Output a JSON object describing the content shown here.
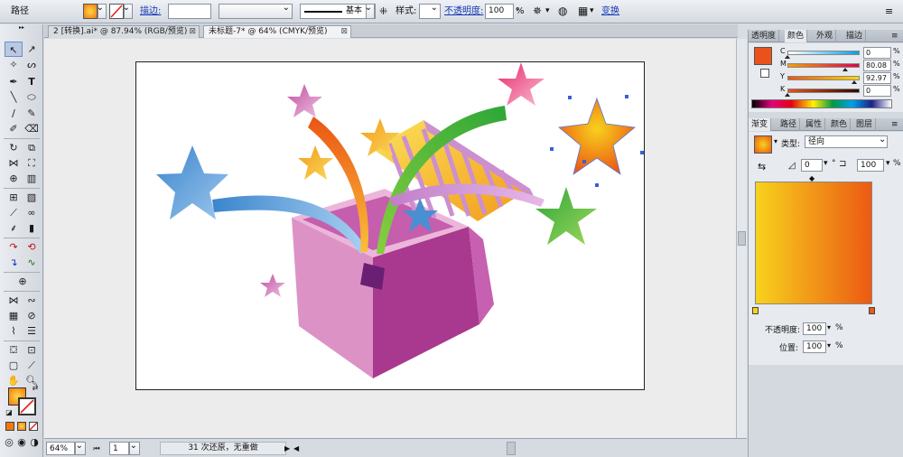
{
  "control_bar": {
    "path_label": "路径",
    "fill_color": "#f07a10",
    "stroke_label": "描边:",
    "stroke_weight": "",
    "brush_label": "基本",
    "style_label": "样式:",
    "opacity_label": "不透明度:",
    "opacity_value": "100",
    "opacity_unit": "%",
    "transform_label": "变换"
  },
  "tabs": [
    {
      "label": "2 [转换].ai* @ 87.94% (RGB/预览)",
      "close": "⊠"
    },
    {
      "label": "未标题-7* @ 64% (CMYK/预览)",
      "close": "⊠"
    }
  ],
  "status": {
    "zoom": "64%",
    "page": "1",
    "message": "31 次还原，无重做",
    "play_icon": "▶",
    "prev_icon": "◀"
  },
  "color_panel": {
    "tabs": [
      "透明度",
      "颜色",
      "外观",
      "描边"
    ],
    "active_tab": "颜色",
    "fill_color": "#e9521a",
    "channels": [
      {
        "name": "C",
        "value": "0",
        "unit": "%",
        "gradient": [
          "#ffffff",
          "#00a0e9"
        ]
      },
      {
        "name": "M",
        "value": "80.08",
        "unit": "%",
        "gradient": [
          "#f5a000",
          "#e2004d"
        ]
      },
      {
        "name": "Y",
        "value": "92.97",
        "unit": "%",
        "gradient": [
          "#ea5514",
          "#ffd800"
        ]
      },
      {
        "name": "K",
        "value": "0",
        "unit": "%",
        "gradient": [
          "#e9521a",
          "#2a0a00"
        ]
      }
    ]
  },
  "gradient_panel": {
    "tabs": [
      "渐变",
      "路径",
      "属性",
      "颜色",
      "图层"
    ],
    "active_tab": "渐变",
    "type_label": "类型:",
    "type_value": "径向",
    "angle_value": "0",
    "angle_unit": "°",
    "ratio_value": "100",
    "ratio_unit": "%",
    "start_color": "#f7d21c",
    "end_color": "#ec5a14",
    "opacity_label": "不透明度:",
    "opacity_value": "100",
    "location_label": "位置:",
    "location_value": "100",
    "unit": "%"
  },
  "artwork": {
    "box_colors": [
      "#dd92c6",
      "#c760b0",
      "#a3378c",
      "#ecb6da"
    ],
    "lid_colors": [
      "#f7c63a",
      "#cc8fd0"
    ],
    "star_colors": [
      "#4a8fd1",
      "#f28a1c",
      "#e8256e",
      "#3fb64b",
      "#cc68ac",
      "#f2a421"
    ]
  }
}
